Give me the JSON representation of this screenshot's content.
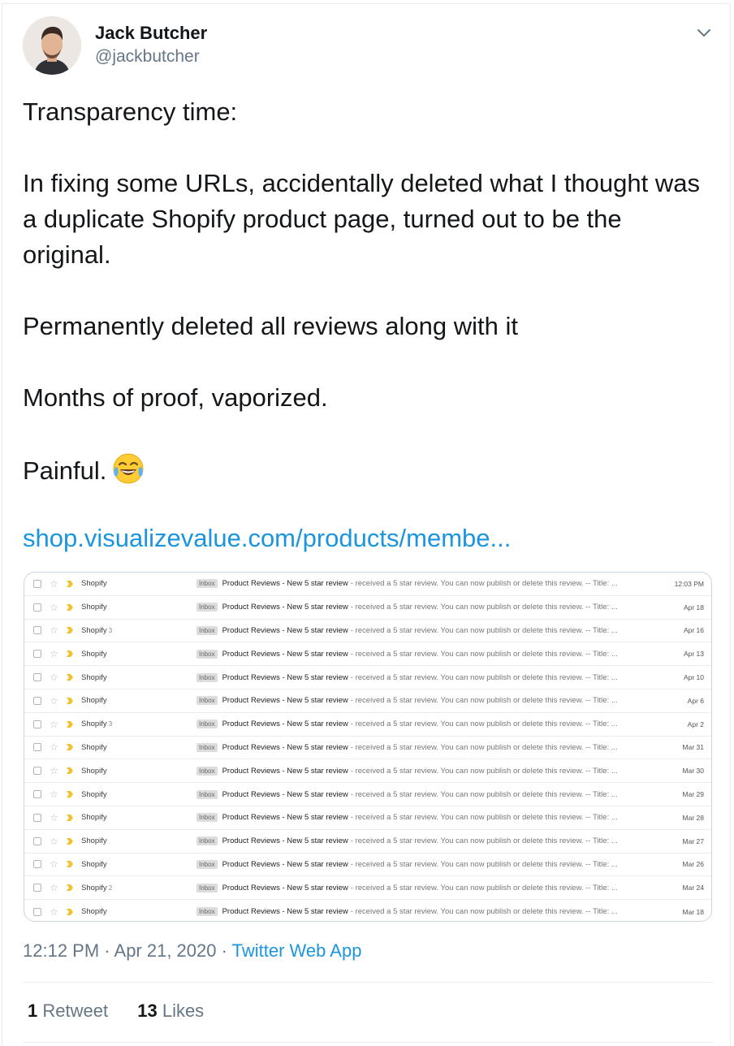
{
  "author": {
    "name": "Jack Butcher",
    "handle": "@jackbutcher",
    "avatar_icon": "user-avatar"
  },
  "tweet": {
    "paragraphs": [
      "Transparency time:",
      "In fixing some URLs, accidentally deleted what I thought was a duplicate Shopify product page, turned out to be the original.",
      "Permanently deleted all reviews along with it",
      "Months of proof, vaporized."
    ],
    "last_line": "Painful.",
    "emoji": "face-with-tears-of-joy",
    "link": "shop.visualizevalue.com/products/membe..."
  },
  "media": {
    "rows": [
      {
        "sender": "Shopify",
        "count": "",
        "badge": "Inbox",
        "subject": "Product Reviews - New 5 star review",
        "snippet": " - received a 5 star review. You can now publish or delete this review. -- Title: ...",
        "date": "12:03 PM"
      },
      {
        "sender": "Shopify",
        "count": "",
        "badge": "Inbox",
        "subject": "Product Reviews - New 5 star review",
        "snippet": " - received a 5 star review. You can now publish or delete this review. -- Title: ...",
        "date": "Apr 18"
      },
      {
        "sender": "Shopify",
        "count": "3",
        "badge": "Inbox",
        "subject": "Product Reviews - New 5 star review",
        "snippet": " - received a 5 star review. You can now publish or delete this review. -- Title: ...",
        "date": "Apr 16"
      },
      {
        "sender": "Shopify",
        "count": "",
        "badge": "Inbox",
        "subject": "Product Reviews - New 5 star review",
        "snippet": " - received a 5 star review. You can now publish or delete this review. -- Title: ...",
        "date": "Apr 13"
      },
      {
        "sender": "Shopify",
        "count": "",
        "badge": "Inbox",
        "subject": "Product Reviews - New 5 star review",
        "snippet": " - received a 5 star review. You can now publish or delete this review. -- Title: ...",
        "date": "Apr 10"
      },
      {
        "sender": "Shopify",
        "count": "",
        "badge": "Inbox",
        "subject": "Product Reviews - New 5 star review",
        "snippet": " - received a 5 star review. You can now publish or delete this review. -- Title: ...",
        "date": "Apr 6"
      },
      {
        "sender": "Shopify",
        "count": "3",
        "badge": "Inbox",
        "subject": "Product Reviews - New 5 star review",
        "snippet": " - received a 5 star review. You can now publish or delete this review. -- Title: ...",
        "date": "Apr 2"
      },
      {
        "sender": "Shopify",
        "count": "",
        "badge": "Inbox",
        "subject": "Product Reviews - New 5 star review",
        "snippet": " - received a 5 star review. You can now publish or delete this review. -- Title: ...",
        "date": "Mar 31"
      },
      {
        "sender": "Shopify",
        "count": "",
        "badge": "Inbox",
        "subject": "Product Reviews - New 5 star review",
        "snippet": " - received a 5 star review. You can now publish or delete this review. -- Title: ...",
        "date": "Mar 30"
      },
      {
        "sender": "Shopify",
        "count": "",
        "badge": "Inbox",
        "subject": "Product Reviews - New 5 star review",
        "snippet": " - received a 5 star review. You can now publish or delete this review. -- Title: ...",
        "date": "Mar 29"
      },
      {
        "sender": "Shopify",
        "count": "",
        "badge": "Inbox",
        "subject": "Product Reviews - New 5 star review",
        "snippet": " - received a 5 star review. You can now publish or delete this review. -- Title: ...",
        "date": "Mar 28"
      },
      {
        "sender": "Shopify",
        "count": "",
        "badge": "Inbox",
        "subject": "Product Reviews - New 5 star review",
        "snippet": " - received a 5 star review. You can now publish or delete this review. -- Title: ...",
        "date": "Mar 27"
      },
      {
        "sender": "Shopify",
        "count": "",
        "badge": "Inbox",
        "subject": "Product Reviews - New 5 star review",
        "snippet": " - received a 5 star review. You can now publish or delete this review. -- Title: ...",
        "date": "Mar 26"
      },
      {
        "sender": "Shopify",
        "count": "2",
        "badge": "Inbox",
        "subject": "Product Reviews - New 5 star review",
        "snippet": " - received a 5 star review. You can now publish or delete this review. -- Title: ...",
        "date": "Mar 24"
      },
      {
        "sender": "Shopify",
        "count": "",
        "badge": "Inbox",
        "subject": "Product Reviews - New 5 star review",
        "snippet": " - received a 5 star review. You can now publish or delete this review. -- Title: ...",
        "date": "Mar 18"
      }
    ]
  },
  "meta": {
    "time": "12:12 PM",
    "sep1": " · ",
    "date": "Apr 21, 2020",
    "sep2": " · ",
    "app": "Twitter Web App"
  },
  "stats": {
    "retweets_count": "1",
    "retweets_label": "Retweet",
    "likes_count": "13",
    "likes_label": "Likes"
  },
  "colors": {
    "link": "#1b95e0",
    "secondary": "#657786",
    "importance_marker": "#f2c12e"
  }
}
